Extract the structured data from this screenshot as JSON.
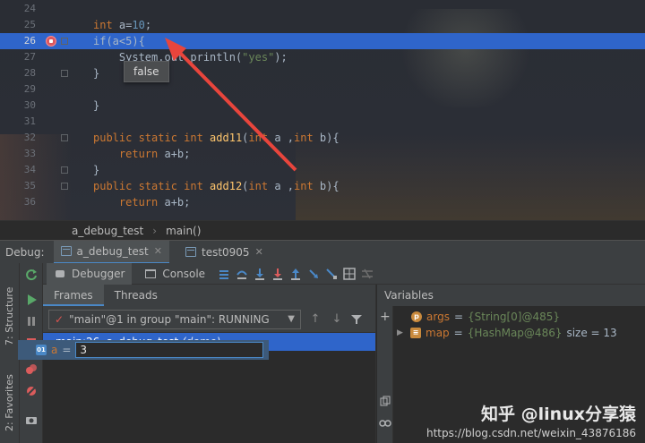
{
  "editor": {
    "lines": [
      {
        "num": "24",
        "code": ""
      },
      {
        "num": "25",
        "code_parts": [
          [
            "kw",
            "int"
          ],
          [
            "plain",
            " a="
          ],
          [
            "numlit",
            "10"
          ],
          [
            "plain",
            ";"
          ]
        ]
      },
      {
        "num": "26",
        "code_parts": [
          [
            "plain",
            "if(a<5){"
          ]
        ],
        "current": true,
        "breakpoint": true
      },
      {
        "num": "27",
        "code_parts": [
          [
            "plain",
            "    System.out.println("
          ],
          [
            "str",
            "\"yes\""
          ],
          [
            "plain",
            ");"
          ]
        ]
      },
      {
        "num": "28",
        "code_parts": [
          [
            "plain",
            "}"
          ]
        ]
      },
      {
        "num": "29",
        "code": ""
      },
      {
        "num": "30",
        "code_parts": [
          [
            "plain",
            "}"
          ]
        ]
      },
      {
        "num": "31",
        "code": ""
      },
      {
        "num": "32",
        "code_parts": [
          [
            "kw",
            "public static int "
          ],
          [
            "fn",
            "add11"
          ],
          [
            "plain",
            "("
          ],
          [
            "kw",
            "int"
          ],
          [
            "plain",
            " a ,"
          ],
          [
            "kw",
            "int"
          ],
          [
            "plain",
            " b){"
          ]
        ]
      },
      {
        "num": "33",
        "code_parts": [
          [
            "kw",
            "    return"
          ],
          [
            "plain",
            " a+b;"
          ]
        ]
      },
      {
        "num": "34",
        "code_parts": [
          [
            "plain",
            "}"
          ]
        ]
      },
      {
        "num": "35",
        "code_parts": [
          [
            "kw",
            "public static int "
          ],
          [
            "fn",
            "add12"
          ],
          [
            "plain",
            "("
          ],
          [
            "kw",
            "int"
          ],
          [
            "plain",
            " a ,"
          ],
          [
            "kw",
            "int"
          ],
          [
            "plain",
            " b){"
          ]
        ]
      },
      {
        "num": "36",
        "code_parts": [
          [
            "kw",
            "    return"
          ],
          [
            "plain",
            " a+b;"
          ]
        ]
      }
    ],
    "tooltip": "false"
  },
  "breadcrumb": {
    "class_name": "a_debug_test",
    "separator": "›",
    "method": "main()"
  },
  "debug": {
    "label": "Debug:",
    "tabs": [
      {
        "label": "a_debug_test",
        "active": true
      },
      {
        "label": "test0905",
        "active": false
      }
    ],
    "toolbar": {
      "debugger_label": "Debugger",
      "console_label": "Console"
    },
    "frames_tab": "Frames",
    "threads_tab": "Threads",
    "thread_selected": "\"main\"@1 in group \"main\": RUNNING",
    "frame_location": "main:26, a_debug_test",
    "frame_module": "(demo)",
    "variables_title": "Variables",
    "variables": [
      {
        "badge": "p",
        "badge_color": "#c98a3d",
        "name": "args",
        "value": "{String[0]@485}"
      },
      {
        "badge": "≡",
        "badge_color": "#c98a3d",
        "name": "map",
        "value": "{HashMap@486}",
        "meta": "size = 13",
        "expandable": true
      }
    ],
    "eval": {
      "badge": "01",
      "name": "a",
      "value": "3"
    }
  },
  "side_labels": {
    "structure": "7: Structure",
    "favorites": "2: Favorites"
  },
  "watermark": {
    "brand": "知乎 @linux分享猿",
    "url": "https://blog.csdn.net/weixin_43876186"
  },
  "colors": {
    "accent": "#2f65ca",
    "breakpoint": "#db5860",
    "arrow": "#e8453c"
  }
}
